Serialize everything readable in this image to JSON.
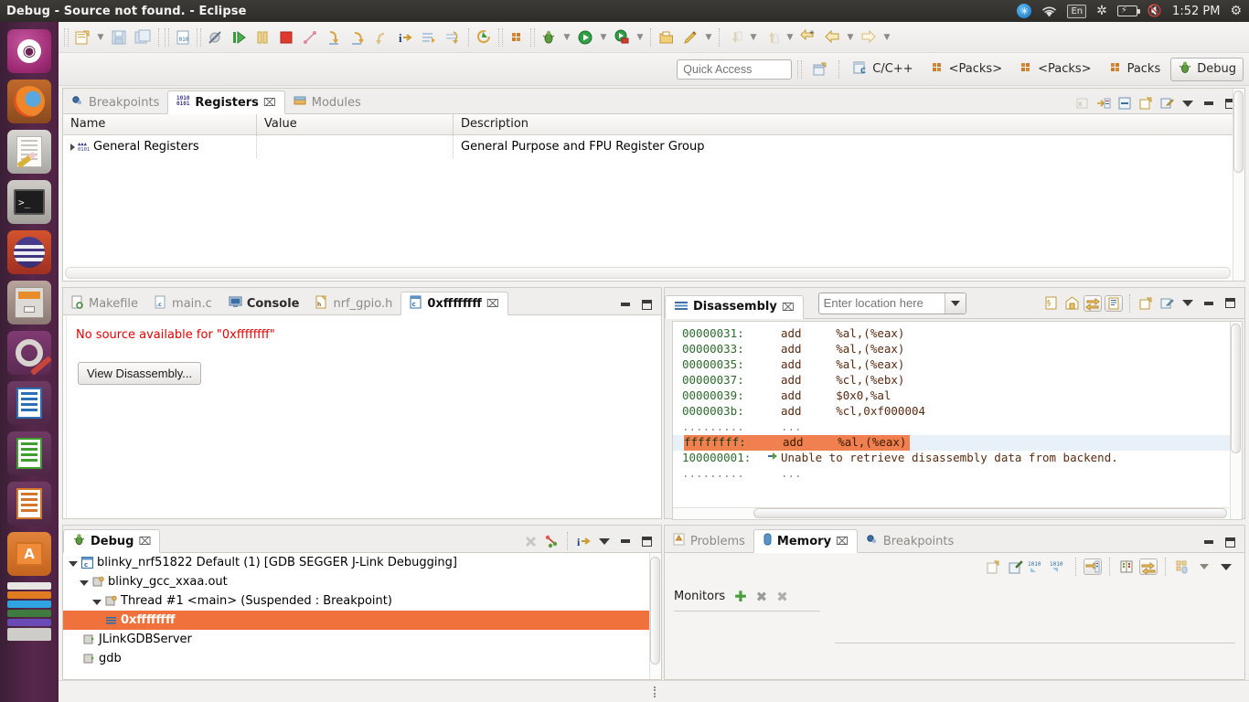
{
  "window": {
    "title": "Debug - Source not found. - Eclipse"
  },
  "tray": {
    "bluetooth_icon": "bluetooth-icon",
    "wifi_icon": "wifi-icon",
    "keyboard_layout": "En",
    "bluetooth2_icon": "bluetooth-indicator-icon",
    "battery_icon": "battery-icon",
    "volume_icon": "volume-muted-icon",
    "clock": "1:52 PM",
    "session_icon": "session-gear-icon"
  },
  "launcher": {
    "items": [
      {
        "name": "ubuntu-dash",
        "label": "Dash home"
      },
      {
        "name": "firefox",
        "label": "Firefox Web Browser"
      },
      {
        "name": "text-editor",
        "label": "Text Editor"
      },
      {
        "name": "terminal",
        "label": "Terminal"
      },
      {
        "name": "software-updater",
        "label": "Software Updater"
      },
      {
        "name": "files",
        "label": "Files"
      },
      {
        "name": "system-settings",
        "label": "System Settings"
      },
      {
        "name": "libreoffice-writer",
        "label": "LibreOffice Writer"
      },
      {
        "name": "libreoffice-calc",
        "label": "LibreOffice Calc"
      },
      {
        "name": "libreoffice-impress",
        "label": "LibreOffice Impress"
      },
      {
        "name": "ubuntu-software",
        "label": "Ubuntu Software Center"
      },
      {
        "name": "amazon",
        "label": "Amazon"
      }
    ]
  },
  "toolbar": {
    "items": [
      {
        "name": "new-button",
        "icon": "new-file-icon"
      },
      {
        "name": "new-dropdown",
        "icon": "chevron-down-icon"
      },
      {
        "name": "save-button",
        "icon": "save-icon"
      },
      {
        "name": "save-all-button",
        "icon": "save-all-icon"
      },
      {
        "name": "memory-view-button",
        "icon": "binary-file-icon"
      },
      {
        "name": "skip-breakpoints-button",
        "icon": "skip-breakpoints-icon"
      },
      {
        "name": "resume-button",
        "icon": "resume-icon"
      },
      {
        "name": "suspend-button",
        "icon": "suspend-icon"
      },
      {
        "name": "terminate-button",
        "icon": "terminate-icon"
      },
      {
        "name": "disconnect-button",
        "icon": "disconnect-icon"
      },
      {
        "name": "step-into-button",
        "icon": "step-into-icon"
      },
      {
        "name": "step-over-button",
        "icon": "step-over-icon"
      },
      {
        "name": "step-return-button",
        "icon": "step-return-icon"
      },
      {
        "name": "instruction-stepping-button",
        "icon": "instruction-stepping-icon"
      },
      {
        "name": "drop-to-frame-button",
        "icon": "drop-to-frame-icon"
      },
      {
        "name": "use-step-filters-button",
        "icon": "step-filters-icon"
      },
      {
        "name": "restart-button",
        "icon": "restart-icon"
      },
      {
        "name": "build-all-button",
        "icon": "build-all-icon"
      },
      {
        "name": "debug-button",
        "icon": "debug-bug-icon"
      },
      {
        "name": "debug-dropdown",
        "icon": "chevron-down-icon"
      },
      {
        "name": "run-button",
        "icon": "run-play-icon"
      },
      {
        "name": "run-dropdown",
        "icon": "chevron-down-icon"
      },
      {
        "name": "external-tools-button",
        "icon": "external-tools-icon"
      },
      {
        "name": "external-tools-dropdown",
        "icon": "chevron-down-icon"
      },
      {
        "name": "open-folder-button",
        "icon": "open-folder-icon"
      },
      {
        "name": "highlight-button",
        "icon": "marker-icon"
      },
      {
        "name": "highlight-dropdown",
        "icon": "chevron-down-icon"
      },
      {
        "name": "next-annotation-button",
        "icon": "next-annotation-icon"
      },
      {
        "name": "next-annotation-dropdown",
        "icon": "chevron-down-icon"
      },
      {
        "name": "previous-annotation-button",
        "icon": "previous-annotation-icon"
      },
      {
        "name": "previous-annotation-dropdown",
        "icon": "chevron-down-icon"
      },
      {
        "name": "last-edit-location-button",
        "icon": "last-edit-location-icon"
      },
      {
        "name": "back-button",
        "icon": "back-arrow-icon"
      },
      {
        "name": "back-dropdown",
        "icon": "chevron-down-icon"
      },
      {
        "name": "forward-button",
        "icon": "forward-arrow-icon"
      },
      {
        "name": "forward-dropdown",
        "icon": "chevron-down-icon"
      }
    ]
  },
  "quick_access": {
    "placeholder": "Quick Access",
    "value": ""
  },
  "perspectives": {
    "open_perspective_icon": "open-perspective-icon",
    "items": [
      {
        "label": "C/C++",
        "icon": "c-cpp-perspective-icon",
        "active": false
      },
      {
        "label": "<Packs>",
        "icon": "packs-perspective-icon",
        "active": false
      },
      {
        "label": "<Packs>",
        "icon": "packs-perspective-icon",
        "active": false
      },
      {
        "label": "Packs",
        "icon": "packs-perspective-icon",
        "active": false
      },
      {
        "label": "Debug",
        "icon": "debug-perspective-icon",
        "active": true
      }
    ]
  },
  "registers_view": {
    "tabs": [
      {
        "label": "Breakpoints",
        "icon": "breakpoints-icon",
        "active": false,
        "closeable": false
      },
      {
        "label": "Registers",
        "icon": "registers-icon",
        "active": true,
        "closeable": true
      },
      {
        "label": "Modules",
        "icon": "modules-icon",
        "active": false,
        "closeable": false
      }
    ],
    "close_label": "⌧",
    "tools": [
      {
        "name": "hexadecimal-toggle",
        "icon": "hex-format-icon"
      },
      {
        "name": "show-type-names-button",
        "icon": "show-type-names-icon"
      },
      {
        "name": "collapse-all-button",
        "icon": "collapse-all-icon"
      },
      {
        "name": "new-register-group-button",
        "icon": "new-register-group-icon"
      },
      {
        "name": "edit-register-group-button",
        "icon": "edit-register-group-icon"
      },
      {
        "name": "view-menu-button",
        "icon": "view-menu-icon"
      },
      {
        "name": "minimize-button",
        "icon": "minimize-icon"
      },
      {
        "name": "maximize-button",
        "icon": "maximize-icon"
      }
    ],
    "columns": [
      "Name",
      "Value",
      "Description"
    ],
    "rows": [
      {
        "name": "General Registers",
        "value": "",
        "description": "General Purpose and FPU Register Group",
        "icon": "register-group-icon",
        "expandable": true
      }
    ]
  },
  "editor_area": {
    "tabs": [
      {
        "label": "Makefile",
        "icon": "makefile-icon",
        "active": false,
        "closeable": false
      },
      {
        "label": "main.c",
        "icon": "c-source-icon",
        "active": false,
        "closeable": false
      },
      {
        "label": "Console",
        "icon": "console-icon",
        "active": false,
        "closeable": false,
        "bold": true
      },
      {
        "label": "nrf_gpio.h",
        "icon": "c-header-icon",
        "active": false,
        "closeable": false
      },
      {
        "label": "0xffffffff",
        "icon": "c-source-icon",
        "active": true,
        "closeable": true
      }
    ],
    "close_label": "⌧",
    "tools": [
      {
        "name": "minimize-button",
        "icon": "minimize-icon"
      },
      {
        "name": "maximize-button",
        "icon": "maximize-icon"
      }
    ],
    "message": "No source available for \"0xffffffff\"",
    "button_label": "View Disassembly..."
  },
  "disassembly_view": {
    "tabs": [
      {
        "label": "Disassembly",
        "icon": "disassembly-icon",
        "active": true,
        "closeable": true
      }
    ],
    "close_label": "⌧",
    "location_input": {
      "placeholder": "Enter location here",
      "value": ""
    },
    "tools": [
      {
        "name": "show-source-button",
        "icon": "show-source-icon",
        "toggled": false
      },
      {
        "name": "show-symbols-button",
        "icon": "show-symbols-icon",
        "toggled": false
      },
      {
        "name": "link-with-active-debug-context-button",
        "icon": "link-debug-context-icon",
        "toggled": true
      },
      {
        "name": "show-opcodes-button",
        "icon": "show-opcodes-icon",
        "toggled": true
      },
      {
        "name": "new-disassembly-view-button",
        "icon": "new-view-icon"
      },
      {
        "name": "pin-view-button",
        "icon": "pin-view-icon"
      },
      {
        "name": "view-menu-button",
        "icon": "view-menu-icon"
      },
      {
        "name": "minimize-button",
        "icon": "minimize-icon"
      },
      {
        "name": "maximize-button",
        "icon": "maximize-icon"
      }
    ],
    "lines": [
      {
        "address": "00000031:",
        "text": "add     %al,(%eax)",
        "kind": "code"
      },
      {
        "address": "00000033:",
        "text": "add     %al,(%eax)",
        "kind": "code"
      },
      {
        "address": "00000035:",
        "text": "add     %al,(%eax)",
        "kind": "code"
      },
      {
        "address": "00000037:",
        "text": "add     %cl,(%ebx)",
        "kind": "code"
      },
      {
        "address": "00000039:",
        "text": "add     $0x0,%al",
        "kind": "code"
      },
      {
        "address": "0000003b:",
        "text": "add     %cl,0xf000004",
        "kind": "code"
      },
      {
        "address": ".........",
        "text": "...",
        "kind": "ellipsis"
      },
      {
        "address": "ffffffff:",
        "text": "add     %al,(%eax)",
        "kind": "current"
      },
      {
        "address": "100000001:",
        "text": "Unable to retrieve disassembly data from backend.",
        "kind": "error"
      },
      {
        "address": ".........",
        "text": "...",
        "kind": "ellipsis"
      }
    ]
  },
  "debug_view": {
    "tabs": [
      {
        "label": "Debug",
        "icon": "debug-view-icon",
        "active": true,
        "closeable": true
      }
    ],
    "close_label": "⌧",
    "tools": [
      {
        "name": "remove-all-terminated-button",
        "icon": "remove-all-terminated-icon"
      },
      {
        "name": "show-debug-toolbar-button",
        "icon": "debug-toolbar-icon"
      },
      {
        "name": "instruction-stepping-mode-button",
        "icon": "instruction-stepping-icon"
      },
      {
        "name": "view-menu-button",
        "icon": "view-menu-icon"
      },
      {
        "name": "minimize-button",
        "icon": "minimize-icon"
      },
      {
        "name": "maximize-button",
        "icon": "maximize-icon"
      }
    ],
    "tree": [
      {
        "label": "blinky_nrf51822 Default (1) [GDB SEGGER J-Link Debugging]",
        "indent": 0,
        "twisty": "open",
        "icon": "launch-config-icon",
        "selected": false
      },
      {
        "label": "blinky_gcc_xxaa.out",
        "indent": 1,
        "twisty": "open",
        "icon": "process-icon",
        "selected": false
      },
      {
        "label": "Thread #1 <main> (Suspended : Breakpoint)",
        "indent": 2,
        "twisty": "open",
        "icon": "thread-icon",
        "selected": false
      },
      {
        "label": "0xffffffff",
        "indent": 3,
        "twisty": "none",
        "icon": "stack-frame-icon",
        "selected": true
      },
      {
        "label": "JLinkGDBServer",
        "indent": 1,
        "twisty": "none",
        "icon": "process-icon",
        "selected": false
      },
      {
        "label": "gdb",
        "indent": 1,
        "twisty": "none",
        "icon": "process-icon",
        "selected": false
      }
    ]
  },
  "memory_view": {
    "tabs": [
      {
        "label": "Problems",
        "icon": "problems-icon",
        "active": false,
        "closeable": false
      },
      {
        "label": "Memory",
        "icon": "memory-icon",
        "active": true,
        "closeable": true
      },
      {
        "label": "Breakpoints",
        "icon": "breakpoints-icon",
        "active": false,
        "closeable": false
      }
    ],
    "close_label": "⌧",
    "window_tools": [
      {
        "name": "minimize-button",
        "icon": "minimize-icon"
      },
      {
        "name": "maximize-button",
        "icon": "maximize-icon"
      }
    ],
    "tools": [
      {
        "name": "new-memory-view-button",
        "icon": "new-view-icon"
      },
      {
        "name": "pin-memory-view-button",
        "icon": "pin-view-icon"
      },
      {
        "name": "import-button",
        "icon": "import-binary-icon"
      },
      {
        "name": "export-button",
        "icon": "export-binary-icon"
      },
      {
        "name": "link-memory-rendering-panes-button",
        "icon": "link-panes-icon",
        "toggled": true
      },
      {
        "name": "toggle-split-pane-button",
        "icon": "split-pane-icon"
      },
      {
        "name": "toggle-memory-monitors-pane-button",
        "icon": "monitors-pane-icon",
        "toggled": true
      },
      {
        "name": "new-renderings-button",
        "icon": "new-renderings-icon"
      },
      {
        "name": "new-renderings-dropdown",
        "icon": "chevron-down-icon"
      },
      {
        "name": "view-menu-button",
        "icon": "view-menu-icon"
      }
    ],
    "monitors_label": "Monitors",
    "monitor_actions": [
      {
        "name": "add-memory-monitor-button",
        "icon": "add-icon"
      },
      {
        "name": "remove-memory-monitor-button",
        "icon": "remove-icon"
      },
      {
        "name": "remove-all-memory-monitors-button",
        "icon": "remove-all-icon"
      }
    ],
    "monitors": []
  },
  "colors": {
    "selection": "#f0713c",
    "error_text": "#e80000",
    "address": "#2e6b2e",
    "opcode": "#5a2a10",
    "panel_bg": "#f2f1f0",
    "launcher_bg": "#58274c"
  }
}
